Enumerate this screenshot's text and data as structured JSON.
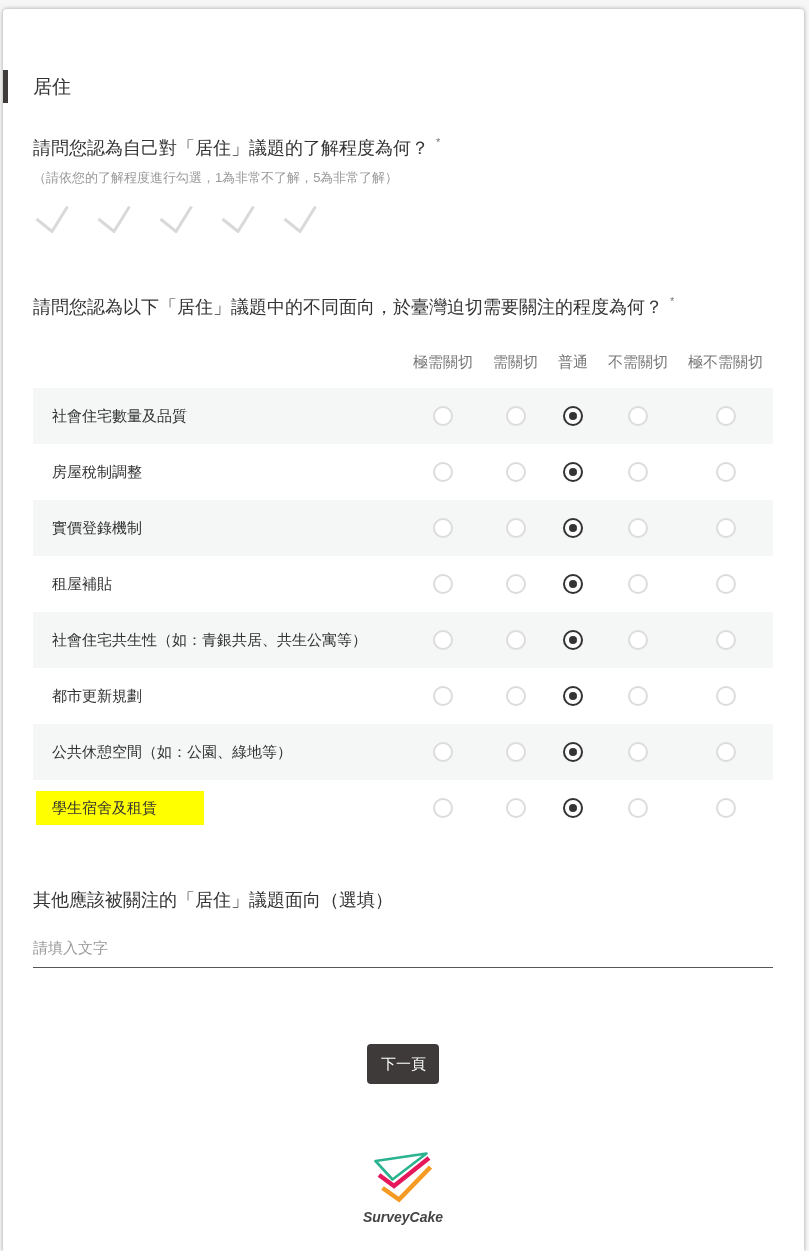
{
  "section": {
    "title": "居住"
  },
  "rating_question": {
    "title": "請問您認為自己對「居住」議題的了解程度為何？ $^{*}$",
    "hint": "（請依您的了解程度進行勾選，1為非常不了解，5為非常了解）",
    "options": [
      {
        "selected": false
      },
      {
        "selected": false
      },
      {
        "selected": false
      },
      {
        "selected": false
      },
      {
        "selected": false
      }
    ]
  },
  "matrix_question": {
    "title": "請問您認為以下「居住」議題中的不同面向，於臺灣迫切需要關注的程度為何？ $^{*}$",
    "columns": [
      "極需關切",
      "需關切",
      "普通",
      "不需關切",
      "極不需關切"
    ],
    "rows": [
      {
        "label": "社會住宅數量及品質",
        "highlighted": false,
        "options": [
          {
            "selected": false
          },
          {
            "selected": false
          },
          {
            "selected": true
          },
          {
            "selected": false
          },
          {
            "selected": false
          }
        ]
      },
      {
        "label": "房屋稅制調整",
        "highlighted": false,
        "options": [
          {
            "selected": false
          },
          {
            "selected": false
          },
          {
            "selected": true
          },
          {
            "selected": false
          },
          {
            "selected": false
          }
        ]
      },
      {
        "label": "實價登錄機制",
        "highlighted": false,
        "options": [
          {
            "selected": false
          },
          {
            "selected": false
          },
          {
            "selected": true
          },
          {
            "selected": false
          },
          {
            "selected": false
          }
        ]
      },
      {
        "label": "租屋補貼",
        "highlighted": false,
        "options": [
          {
            "selected": false
          },
          {
            "selected": false
          },
          {
            "selected": true
          },
          {
            "selected": false
          },
          {
            "selected": false
          }
        ]
      },
      {
        "label": "社會住宅共生性（如：青銀共居、共生公寓等）",
        "highlighted": false,
        "options": [
          {
            "selected": false
          },
          {
            "selected": false
          },
          {
            "selected": true
          },
          {
            "selected": false
          },
          {
            "selected": false
          }
        ]
      },
      {
        "label": "都市更新規劃",
        "highlighted": false,
        "options": [
          {
            "selected": false
          },
          {
            "selected": false
          },
          {
            "selected": true
          },
          {
            "selected": false
          },
          {
            "selected": false
          }
        ]
      },
      {
        "label": "公共休憩空間（如：公園、綠地等）",
        "highlighted": false,
        "options": [
          {
            "selected": false
          },
          {
            "selected": false
          },
          {
            "selected": true
          },
          {
            "selected": false
          },
          {
            "selected": false
          }
        ]
      },
      {
        "label": "學生宿舍及租賃",
        "highlighted": true,
        "options": [
          {
            "selected": false
          },
          {
            "selected": false
          },
          {
            "selected": true
          },
          {
            "selected": false
          },
          {
            "selected": false
          }
        ]
      }
    ]
  },
  "text_question": {
    "title": "其他應該被關注的「居住」議題面向（選填）",
    "placeholder": "請填入文字"
  },
  "next_button": "下一頁",
  "footer": {
    "brand": "SurveyCake"
  }
}
